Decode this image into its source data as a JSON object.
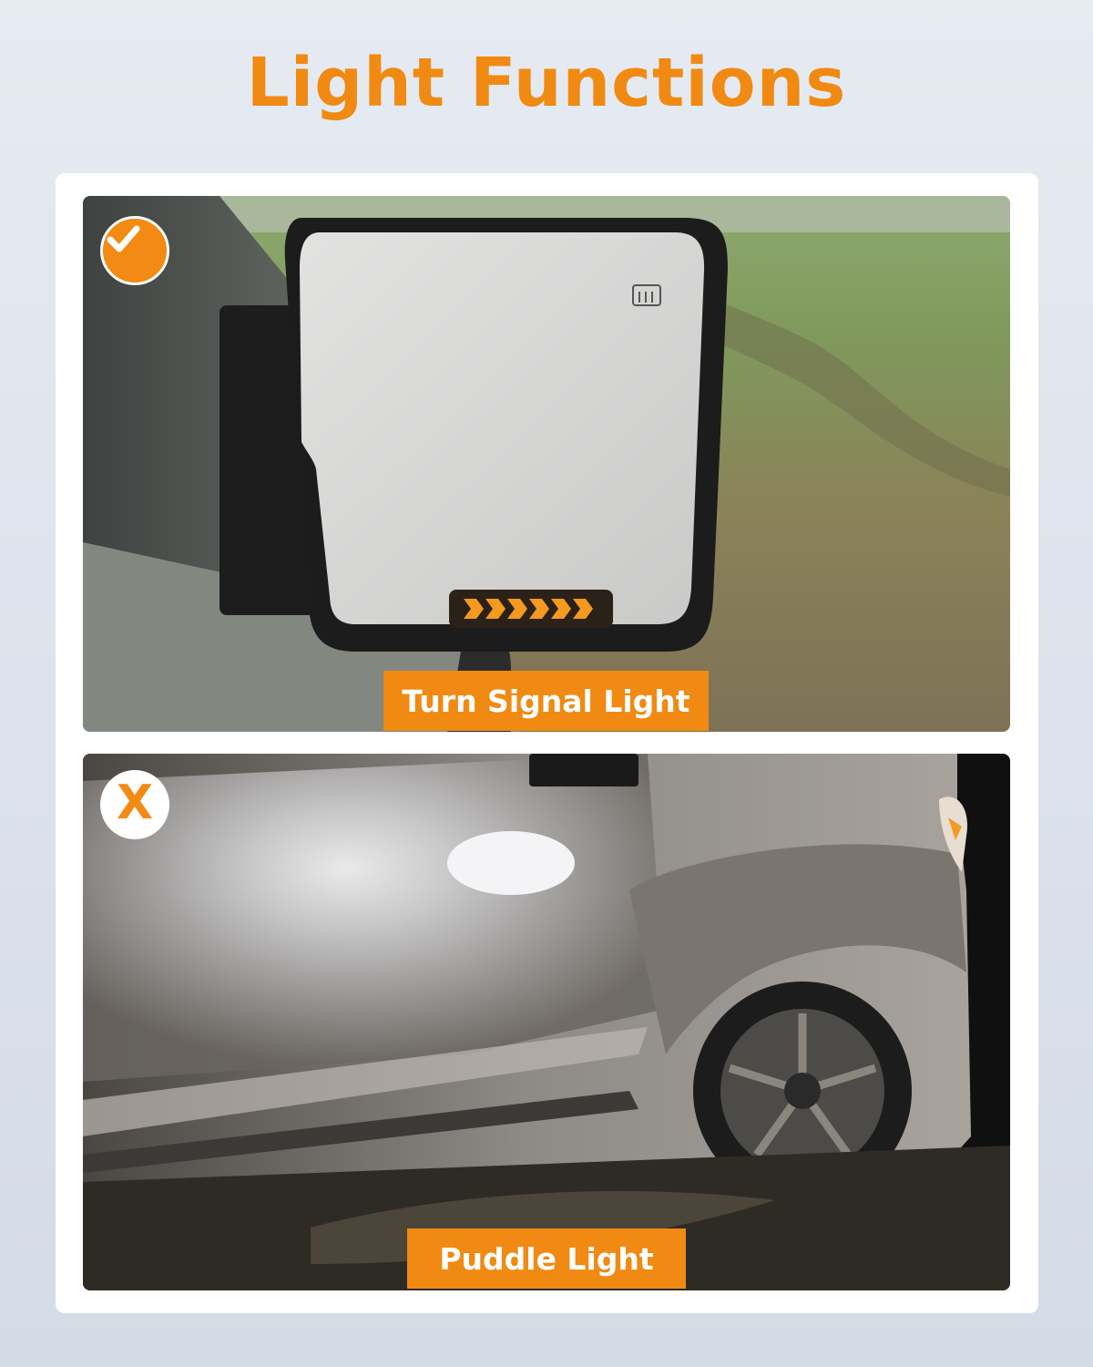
{
  "heading": "Light Functions",
  "panels": [
    {
      "label": "Turn Signal Light",
      "status_icon": "check-icon"
    },
    {
      "label": "Puddle Light",
      "status_icon": "x-icon",
      "status_glyph": "X"
    }
  ],
  "colors": {
    "accent": "#f08a12",
    "background": "#dde3ec",
    "card": "#ffffff",
    "label_text": "#ffffff"
  }
}
